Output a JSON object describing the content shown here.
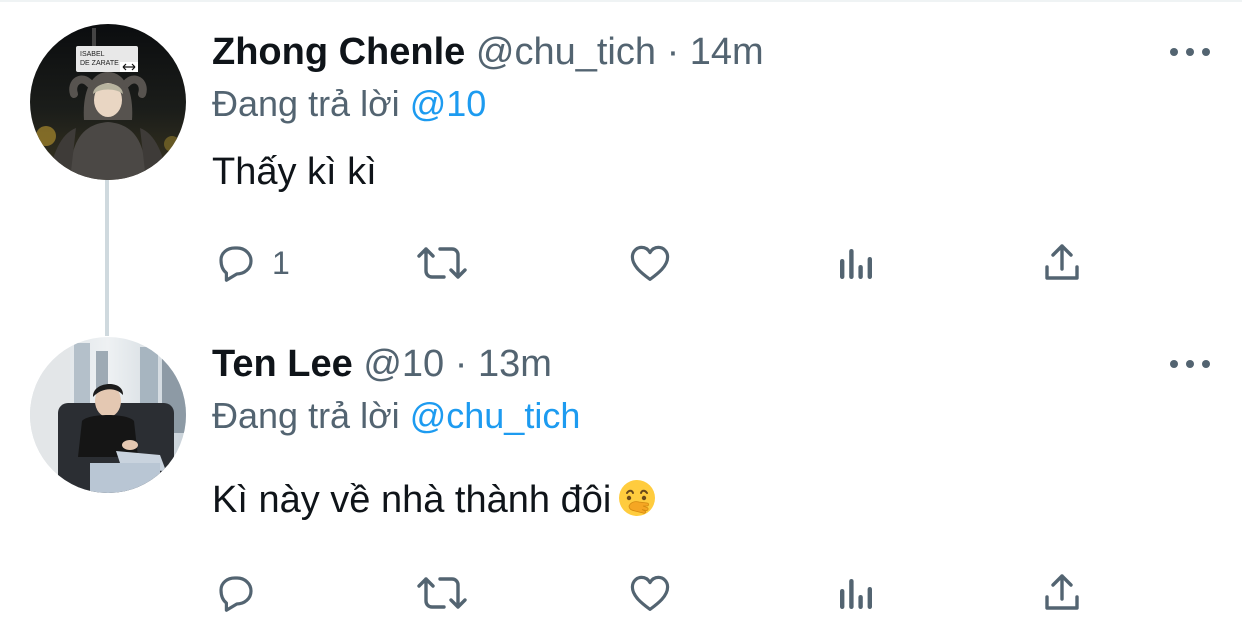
{
  "thread": [
    {
      "display_name": "Zhong Chenle",
      "handle": "@chu_tich",
      "separator": "·",
      "timestamp": "14m",
      "reply_prefix": "Đang trả lời",
      "reply_mention": "@10",
      "text": "Thấy kì kì",
      "emoji": "",
      "reply_count": "1",
      "avatar_sign_text": [
        "ISABEL",
        "DE ZARATE"
      ]
    },
    {
      "display_name": "Ten Lee",
      "handle": "@10",
      "separator": "·",
      "timestamp": "13m",
      "reply_prefix": "Đang trả lời",
      "reply_mention": "@chu_tich",
      "text": "Kì này về nhà thành đôi",
      "emoji": "face-with-hand-over-mouth",
      "reply_count": ""
    }
  ],
  "icons": {
    "reply": "speech-bubble-icon",
    "retweet": "retweet-icon",
    "like": "heart-icon",
    "views": "bar-chart-icon",
    "share": "share-upload-icon",
    "more": "more-dots-icon"
  },
  "colors": {
    "text_primary": "#0f1419",
    "text_secondary": "#536471",
    "accent": "#1d9bf0",
    "thread_line": "#cfd9de"
  }
}
